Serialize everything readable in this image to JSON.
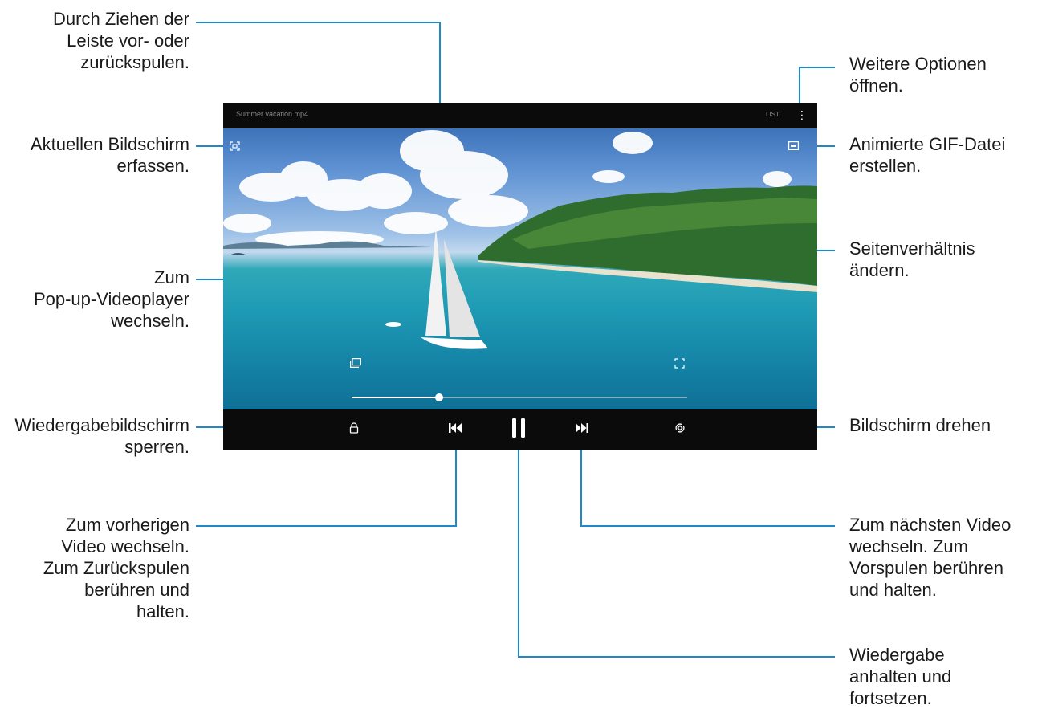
{
  "callouts": {
    "seek": [
      "Durch Ziehen der",
      "Leiste vor- oder",
      "zurückspulen."
    ],
    "capture": [
      "Aktuellen Bildschirm",
      "erfassen."
    ],
    "popup": [
      "Zum",
      "Pop-up-Videoplayer",
      "wechseln."
    ],
    "lock": [
      "Wiedergabebildschirm",
      "sperren."
    ],
    "previous": [
      "Zum vorherigen",
      "Video wechseln.",
      "Zum Zurückspulen",
      "berühren und",
      "halten."
    ],
    "more_options": [
      "Weitere Optionen",
      "öffnen."
    ],
    "gif": [
      "Animierte GIF-Datei",
      "erstellen."
    ],
    "ratio": [
      "Seitenverhältnis",
      "ändern."
    ],
    "rotate": [
      "Bildschirm drehen"
    ],
    "next": [
      "Zum nächsten Video",
      "wechseln. Zum",
      "Vorspulen berühren",
      "und halten."
    ],
    "pause": [
      "Wiedergabe",
      "anhalten und",
      "fortsetzen."
    ]
  },
  "player": {
    "filename": "Summer vacation.mp4",
    "list_label": "LIST",
    "progress": 0.26,
    "icons": {
      "capture": "screenshot-icon",
      "more": "more-options-icon",
      "gif": "gif-icon",
      "popup": "popup-player-icon",
      "ratio": "aspect-ratio-icon",
      "lock": "lock-icon",
      "previous": "skip-previous-icon",
      "pause": "pause-icon",
      "next": "skip-next-icon",
      "rotate": "rotate-screen-icon"
    }
  },
  "colors": {
    "leader_line": "#1e88c8",
    "text": "#1a1a1a"
  }
}
